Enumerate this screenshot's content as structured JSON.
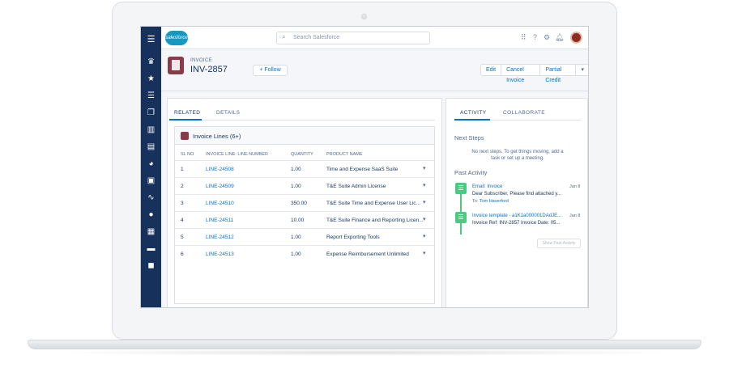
{
  "header": {
    "logo_text": "salesforce",
    "search_placeholder": "Search Salesforce"
  },
  "record": {
    "type_label": "INVOICE",
    "name": "INV-2857",
    "follow_label": "Follow",
    "actions": [
      "Edit",
      "Cancel Invoice",
      "Partial Credit"
    ]
  },
  "left_tabs": [
    "RELATED",
    "DETAILS"
  ],
  "related_list": {
    "title": "Invoice Lines (6+)",
    "columns": [
      "SL NO",
      "INVOICE LINE: LINE NUMBER",
      "QUANTITY",
      "PRODUCT NAME"
    ],
    "rows": [
      {
        "sl": "1",
        "line": "LINE-24508",
        "qty": "1.00",
        "product": "Time and Expense SaaS Suite"
      },
      {
        "sl": "2",
        "line": "LINE-24509",
        "qty": "1.00",
        "product": "T&E Suite Admin License"
      },
      {
        "sl": "3",
        "line": "LINE-24510",
        "qty": "350.00",
        "product": "T&E Suite Time and Expense User Lic..."
      },
      {
        "sl": "4",
        "line": "LINE-24511",
        "qty": "10.00",
        "product": "T&E Suite Finance and Reporting Licen..."
      },
      {
        "sl": "5",
        "line": "LINE-24512",
        "qty": "1.00",
        "product": "Report Exporting Tools"
      },
      {
        "sl": "6",
        "line": "LINE-24513",
        "qty": "1.00",
        "product": "Expense Reimbursement Unlimited"
      }
    ]
  },
  "right_tabs": [
    "ACTIVITY",
    "COLLABORATE"
  ],
  "activity": {
    "next_steps_title": "Next Steps",
    "next_steps_msg": "No next steps. To get things moving, add a task or set up a meeting.",
    "past_title": "Past Activity",
    "items": [
      {
        "title": "Email: Invoice",
        "detail": "Dear Subscriber, Please find attached y...",
        "sub_label": "To:",
        "sub_value": "Tom Haverford",
        "date": "Jan 8"
      },
      {
        "title": "Invoice template - a1K1a000001DAdJE...",
        "detail": "Invoice Ref: INV-2857 Invoice Date: 05...",
        "date": "Jan 8"
      }
    ],
    "show_past_label": "Show Past Activity"
  },
  "colors": {
    "nav": "#16325c",
    "link": "#0070d2",
    "activity_green": "#4bca81",
    "invoice_icon": "#8b3a4a"
  }
}
